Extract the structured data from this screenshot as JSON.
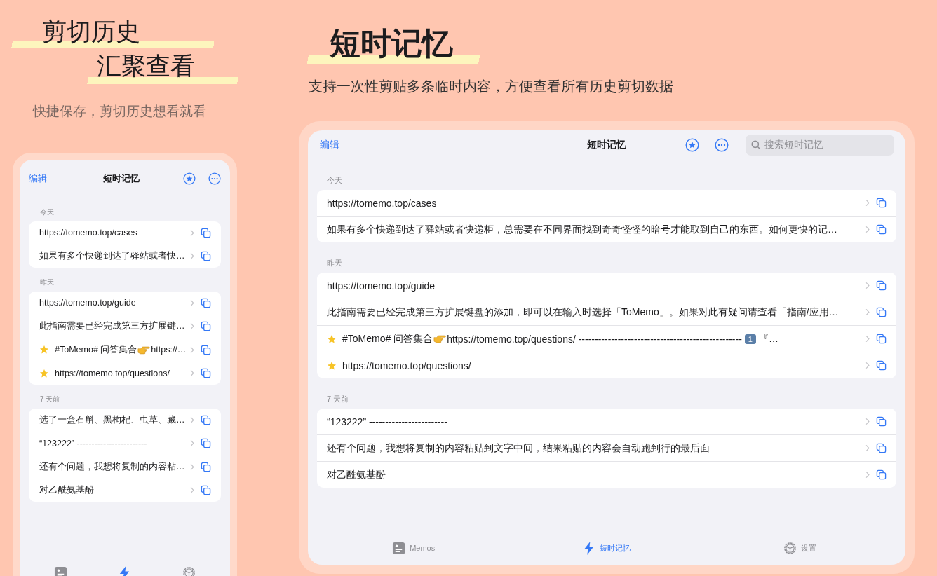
{
  "headline": {
    "line_1": "剪切历史",
    "line_2": "汇聚查看",
    "subtitle": "快捷保存，剪切历史想看就看"
  },
  "feature": {
    "title": "短时记忆",
    "subtitle": "支持一次性剪贴多条临时内容，方便查看所有历史剪切数据"
  },
  "phone": {
    "edit": "编辑",
    "title": "短时记忆",
    "sections": [
      {
        "header": "今天",
        "items": [
          {
            "starred": false,
            "parts": [
              {
                "kind": "text",
                "text": "https://tomemo.top/cases"
              }
            ]
          },
          {
            "starred": false,
            "parts": [
              {
                "kind": "text",
                "text": "如果有多个快递到达了驿站或者快…"
              }
            ]
          }
        ]
      },
      {
        "header": "昨天",
        "items": [
          {
            "starred": false,
            "parts": [
              {
                "kind": "text",
                "text": "https://tomemo.top/guide"
              }
            ]
          },
          {
            "starred": false,
            "parts": [
              {
                "kind": "text",
                "text": "此指南需要已经完成第三方扩展键…"
              }
            ]
          },
          {
            "starred": true,
            "parts": [
              {
                "kind": "text",
                "text": "#ToMemo# 问答集合 "
              },
              {
                "kind": "hand"
              },
              {
                "kind": "text",
                "text": "https://…"
              }
            ]
          },
          {
            "starred": true,
            "parts": [
              {
                "kind": "text",
                "text": "https://tomemo.top/questions/"
              }
            ]
          }
        ]
      },
      {
        "header": "7 天前",
        "items": [
          {
            "starred": false,
            "parts": [
              {
                "kind": "text",
                "text": "选了一盒石斛、黑枸杞、虫草、藏…"
              }
            ]
          },
          {
            "starred": false,
            "parts": [
              {
                "kind": "text",
                "text": "“123222” ------------------------"
              }
            ]
          },
          {
            "starred": false,
            "parts": [
              {
                "kind": "text",
                "text": "还有个问题，我想将复制的内容粘…"
              }
            ]
          },
          {
            "starred": false,
            "parts": [
              {
                "kind": "text",
                "text": "对乙酰氨基酚"
              }
            ]
          }
        ]
      }
    ],
    "tabs": [
      {
        "kind": "memos",
        "selected": false
      },
      {
        "kind": "bolt",
        "selected": true
      },
      {
        "kind": "gear",
        "selected": false
      }
    ]
  },
  "tablet": {
    "edit": "编辑",
    "title": "短时记忆",
    "search": {
      "placeholder": "搜索短时记忆"
    },
    "sections": [
      {
        "header": "今天",
        "items": [
          {
            "starred": false,
            "parts": [
              {
                "kind": "text",
                "text": "https://tomemo.top/cases"
              }
            ]
          },
          {
            "starred": false,
            "parts": [
              {
                "kind": "text",
                "text": "如果有多个快递到达了驿站或者快递柜，总需要在不同界面找到奇奇怪怪的暗号才能取到自己的东西。如何更快的记…"
              }
            ]
          }
        ]
      },
      {
        "header": "昨天",
        "items": [
          {
            "starred": false,
            "parts": [
              {
                "kind": "text",
                "text": "https://tomemo.top/guide"
              }
            ]
          },
          {
            "starred": false,
            "parts": [
              {
                "kind": "text",
                "text": "此指南需要已经完成第三方扩展键盘的添加，即可以在输入时选择「ToMemo」。如果对此有疑问请查看「指南/应用…"
              }
            ]
          },
          {
            "starred": true,
            "parts": [
              {
                "kind": "text",
                "text": "#ToMemo# 问答集合 "
              },
              {
                "kind": "hand"
              },
              {
                "kind": "text",
                "text": "https://tomemo.top/questions/ --------------------------------------------------"
              },
              {
                "kind": "keycap",
                "text": "1"
              },
              {
                "kind": "text",
                "text": "『…"
              }
            ]
          },
          {
            "starred": true,
            "parts": [
              {
                "kind": "text",
                "text": "https://tomemo.top/questions/"
              }
            ]
          }
        ]
      },
      {
        "header": "7 天前",
        "items": [
          {
            "starred": false,
            "parts": [
              {
                "kind": "text",
                "text": "“123222” ------------------------"
              }
            ]
          },
          {
            "starred": false,
            "parts": [
              {
                "kind": "text",
                "text": "还有个问题，我想将复制的内容粘贴到文字中间，结果粘贴的内容会自动跑到行的最后面"
              }
            ]
          },
          {
            "starred": false,
            "parts": [
              {
                "kind": "text",
                "text": "对乙酰氨基酚"
              }
            ]
          }
        ]
      }
    ],
    "tabs": [
      {
        "kind": "memos",
        "label": "Memos",
        "selected": false
      },
      {
        "kind": "bolt",
        "label": "短时记忆",
        "selected": true
      },
      {
        "kind": "gear",
        "label": "设置",
        "selected": false
      }
    ]
  }
}
